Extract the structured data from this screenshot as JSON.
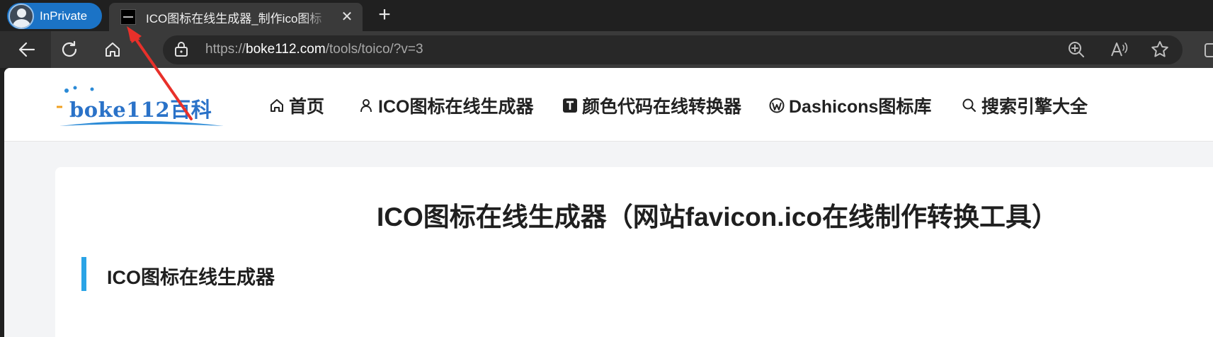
{
  "browser": {
    "profile_label": "InPrivate",
    "tab_title": "ICO图标在线生成器_制作ico图标",
    "tab_close": "✕",
    "new_tab": "+",
    "url_scheme": "https://",
    "url_host": "boke112.com",
    "url_path": "/tools/toico/?v=3"
  },
  "site": {
    "logo_text": "boke112百科",
    "nav": [
      {
        "label": "首页",
        "icon": "home-icon"
      },
      {
        "label": "ICO图标在线生成器",
        "icon": "user-icon"
      },
      {
        "label": "颜色代码在线转换器",
        "icon": "t-square-icon"
      },
      {
        "label": "Dashicons图标库",
        "icon": "wordpress-icon"
      },
      {
        "label": "搜索引擎大全",
        "icon": "search-icon"
      }
    ]
  },
  "content": {
    "page_title": "ICO图标在线生成器（网站favicon.ico在线制作转换工具）",
    "section_title": "ICO图标在线生成器"
  },
  "colors": {
    "inprivate_badge": "#1b73c6",
    "accent_bar": "#2aa4e6",
    "annotation_arrow": "#e8302a"
  }
}
